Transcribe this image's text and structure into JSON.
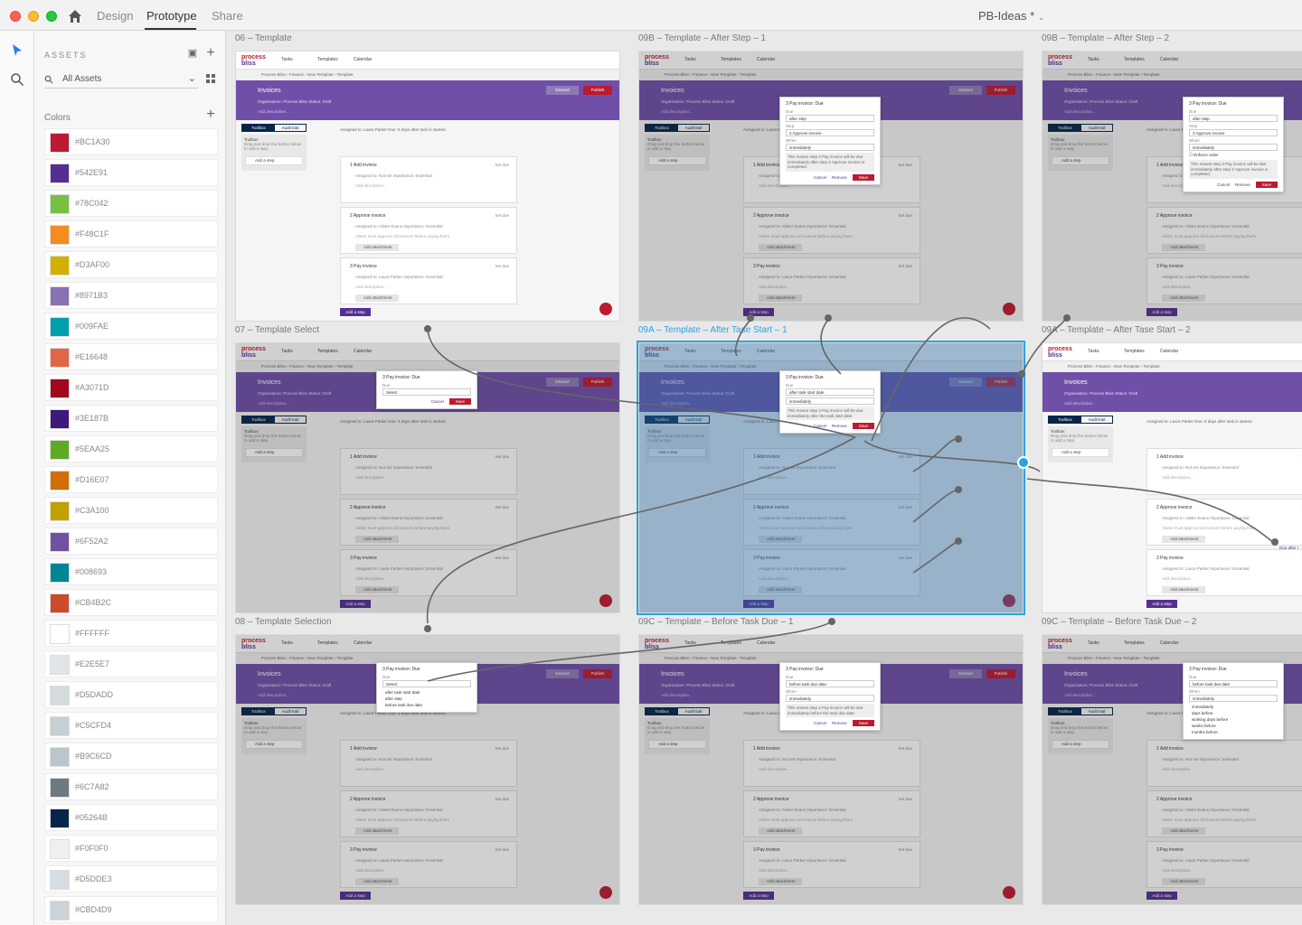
{
  "topbar": {
    "tabs": [
      {
        "label": "Design",
        "active": false
      },
      {
        "label": "Prototype",
        "active": true
      },
      {
        "label": "Share",
        "active": false
      }
    ],
    "doc_title": "PB-Ideas *"
  },
  "assets": {
    "title": "ASSETS",
    "search_label": "All Assets",
    "colors_label": "Colors",
    "colors": [
      "#BC1A30",
      "#542E91",
      "#78C042",
      "#F48C1F",
      "#D3AF00",
      "#8971B3",
      "#009FAE",
      "#E16648",
      "#A3071D",
      "#3E187B",
      "#5EAA25",
      "#D16E07",
      "#C3A100",
      "#6F52A2",
      "#008693",
      "#CB4B2C",
      "#FFFFFF",
      "#E2E5E7",
      "#D5DADD",
      "#C5CFD4",
      "#B9C6CD",
      "#6C7A82",
      "#05264B",
      "#F0F0F0",
      "#D5DDE3",
      "#CBD4D9"
    ]
  },
  "app": {
    "logo_top": "process",
    "logo_bottom": "bliss",
    "nav_tasks": "Tasks",
    "nav_templates": "Templates",
    "nav_calendar": "Calendar",
    "crumb": "Process Bliss  ›  Finance  ›  New Template  ›  Template",
    "banner_title": "Invoices",
    "banner_sub": "Organisation: Process Bliss   Status: Draft",
    "banner_desc": "Add description...",
    "discard": "Discard",
    "publish": "Publish",
    "tab_toolbox": "Toolbox",
    "tab_audit": "Audit trail",
    "toolbox_title": "Toolbox",
    "toolbox_hint": "Drag and drop the button below to add a step.",
    "toolbox_add": "Add a step",
    "assigned_header": "Assigned to: Laura Parker   Due: 5 days after task is started",
    "add_step": "Add a step",
    "steps": [
      {
        "num": "1",
        "name": "Add invoice",
        "assign": "Assigned to: Not set   Importance: Essential",
        "desc": "Add description...",
        "set_due": "Set due",
        "attach": ""
      },
      {
        "num": "2",
        "name": "Approve invoice",
        "assign": "Assigned to: Alister Evans   Importance: Essential",
        "desc": "Alister must approve all invoices before paying them",
        "set_due": "Set due",
        "attach": "Add attachment"
      },
      {
        "num": "3",
        "name": "Pay invoice",
        "assign": "Assigned to: Laura Parker   Importance: Essential",
        "desc": "Add description...",
        "set_due": "Set due",
        "attach": "Add attachment"
      }
    ]
  },
  "artboards": [
    {
      "title": "06 – Template"
    },
    {
      "title": "09B – Template – After Step – 1"
    },
    {
      "title": "09B – Template – After Step – 2"
    },
    {
      "title": "07 – Template Select"
    },
    {
      "title": "09A – Template – After Tase Start – 1"
    },
    {
      "title": "09A – Template – After Tase Start – 2"
    },
    {
      "title": "08 – Template Selection"
    },
    {
      "title": "09C – Template – Before Task Due – 1"
    },
    {
      "title": "09C – Template – Before Task Due – 2"
    }
  ],
  "popups": {
    "title": "3 Pay invoice: Due",
    "due_label": "Due",
    "step_label": "Step",
    "when_label": "When",
    "select": "Select",
    "after_step": "after step",
    "approve": "2 Approve invoice",
    "after_start": "after task start date",
    "before_due": "before task due date",
    "immediately": "immediately",
    "enforce": "Enforce order",
    "note_step": "This means step 3 Pay invoice will be due immediately after step 2 Approve invoice is completed.",
    "note_start": "This means step 3 Pay invoice will be due immediately after the task start date.",
    "note_due": "This means step 3 Pay invoice will be due immediately before the task due date.",
    "cancel": "Cancel",
    "remove": "Remove",
    "save": "Save",
    "unit_options": [
      "immediately",
      "days before",
      "working days before",
      "weeks before",
      "months before"
    ],
    "due_after": "Due after t"
  }
}
